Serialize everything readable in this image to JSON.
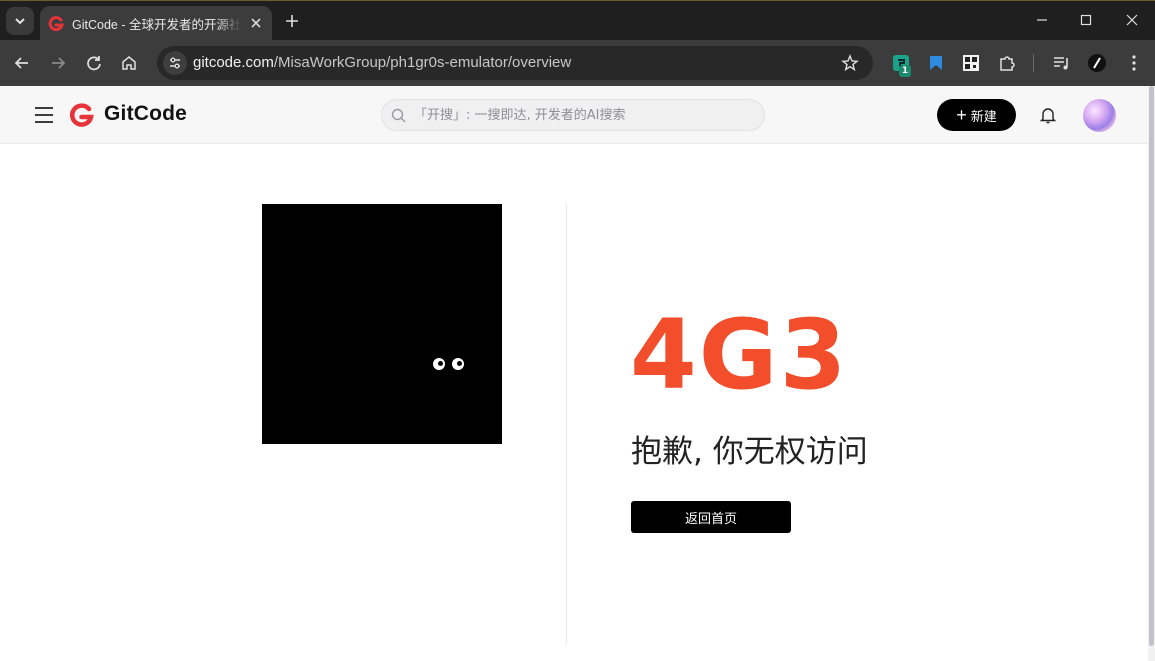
{
  "browser": {
    "tab_title": "GitCode - 全球开发者的开源社区,开源代码托管平台",
    "url_host": "gitcode.com",
    "url_path": "/MisaWorkGroup/ph1gr0s-emulator/overview",
    "extension_badge": "1"
  },
  "header": {
    "logo_text": "GitCode",
    "search_placeholder": "「开搜」: 一搜即达, 开发者的AI搜索",
    "new_button_label": "新建",
    "new_button_icon": "+"
  },
  "main": {
    "error_code": "4G3",
    "error_message": "抱歉, 你无权访问",
    "home_button_label": "返回首页"
  },
  "colors": {
    "brand_red": "#e8333b",
    "error_orange": "#f24e2b",
    "primary_button": "#000000"
  },
  "icons": {
    "tab_menu": "chevron-down-icon",
    "close": "close-icon",
    "new_tab": "plus-icon",
    "back": "arrow-left-icon",
    "forward": "arrow-right-icon",
    "reload": "reload-icon",
    "home": "home-icon",
    "site_info": "tune-icon",
    "bookmark": "star-icon",
    "menu": "hamburger-icon",
    "search": "search-icon",
    "notifications": "bell-icon"
  }
}
